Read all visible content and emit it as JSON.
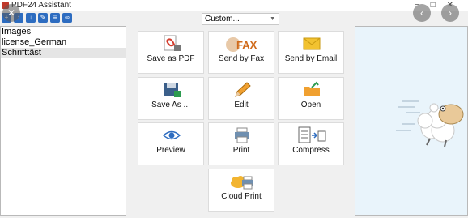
{
  "window": {
    "title": "PDF24 Assistant",
    "controls": [
      "−",
      "□",
      "✕"
    ]
  },
  "toolbar": {
    "icons": [
      "add-icon",
      "upload-icon",
      "download-icon",
      "pencil-icon",
      "list-icon",
      "link-icon"
    ]
  },
  "preset": {
    "value": "Custom..."
  },
  "files": [
    {
      "name": "Images",
      "selected": false
    },
    {
      "name": "license_German",
      "selected": false
    },
    {
      "name": "Schrifttäst",
      "selected": true
    }
  ],
  "actions": [
    {
      "label": "Save as PDF",
      "icon": "pdf-save-icon"
    },
    {
      "label": "Send by Fax",
      "icon": "fax-icon",
      "icon_text": "FAX"
    },
    {
      "label": "Send by Email",
      "icon": "email-icon"
    },
    {
      "label": "Save As ...",
      "icon": "floppy-disk-icon"
    },
    {
      "label": "Edit",
      "icon": "pencil-icon"
    },
    {
      "label": "Open",
      "icon": "open-folder-icon"
    },
    {
      "label": "Preview",
      "icon": "eye-icon"
    },
    {
      "label": "Print",
      "icon": "printer-icon"
    },
    {
      "label": "Compress",
      "icon": "compress-icon"
    },
    {
      "label": "Cloud Print",
      "icon": "cloud-printer-icon"
    }
  ],
  "overlay": {
    "close": "✕",
    "prev": "‹",
    "next": "›"
  },
  "colors": {
    "accent": "#2d6cc0",
    "pdf_red": "#d33b2c",
    "email_yellow": "#f2c230",
    "folder_orange": "#f0a030",
    "fax_orange": "#d06a1a"
  }
}
